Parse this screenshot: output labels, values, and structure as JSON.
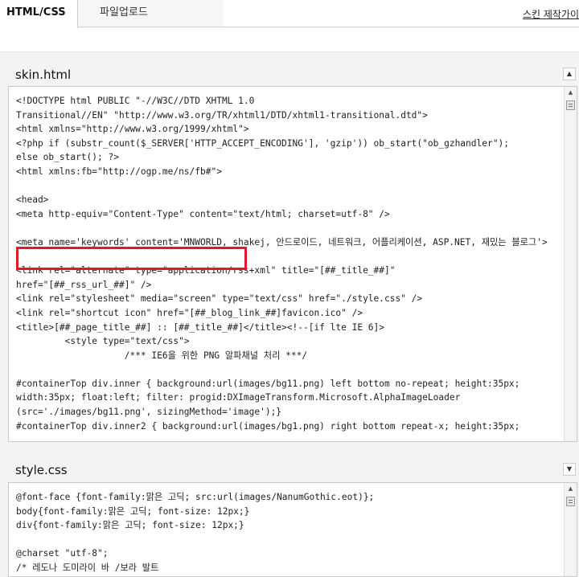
{
  "tabs": {
    "active": "HTML/CSS",
    "upload": "파일업로드",
    "guide": "스킨 제작가이"
  },
  "skin_panel": {
    "title": "skin.html",
    "lines": [
      "<!DOCTYPE html PUBLIC \"-//W3C//DTD XHTML 1.0",
      "Transitional//EN\" \"http://www.w3.org/TR/xhtml1/DTD/xhtml1-transitional.dtd\">",
      "<html xmlns=\"http://www.w3.org/1999/xhtml\">",
      "<?php if (substr_count($_SERVER['HTTP_ACCEPT_ENCODING'], 'gzip')) ob_start(\"ob_gzhandler\");",
      "else ob_start(); ?>",
      "<html xmlns:fb=\"http://ogp.me/ns/fb#\">",
      "",
      "<head>",
      "<meta http-equiv=\"Content-Type\" content=\"text/html; charset=utf-8\" />",
      "",
      "<meta name='keywords' content='MNWORLD, shakej, 안드로이드, 네트워크, 어플리케이션, ASP.NET, 재밌는 블로그'>",
      "",
      "<link rel=\"alternate\" type=\"application/rss+xml\" title=\"[##_title_##]\"",
      "href=\"[##_rss_url_##]\" />",
      "<link rel=\"stylesheet\" media=\"screen\" type=\"text/css\" href=\"./style.css\" />",
      "<link rel=\"shortcut icon\" href=\"[##_blog_link_##]favicon.ico\" />",
      "<title>[##_page_title_##] :: [##_title_##]</title><!--[if lte IE 6]>",
      "         <style type=\"text/css\">",
      "                    /*** IE6을 위한 PNG 알파채널 처리 ***/",
      "",
      "#containerTop div.inner { background:url(images/bg11.png) left bottom no-repeat; height:35px;",
      "width:35px; float:left; filter: progid:DXImageTransform.Microsoft.AlphaImageLoader",
      "(src='./images/bg11.png', sizingMethod='image');}",
      "#containerTop div.inner2 { background:url(images/bg1.png) right bottom repeat-x; height:35px;"
    ]
  },
  "style_panel": {
    "title": "style.css",
    "lines": [
      "@font-face {font-family:맑은 고딕; src:url(images/NanumGothic.eot)};",
      "body{font-family:맑은 고딕; font-size: 12px;}",
      "div{font-family:맑은 고딕; font-size: 12px;}",
      "",
      "@charset \"utf-8\";",
      "/* 레도나 도미라이 바 /보라 발트"
    ]
  },
  "colors": {
    "highlight": "#e3162b"
  },
  "icons": {
    "collapse": "chevron-up-icon",
    "expand": "chevron-down-icon",
    "scroll_up": "scroll-up-arrow-icon"
  }
}
